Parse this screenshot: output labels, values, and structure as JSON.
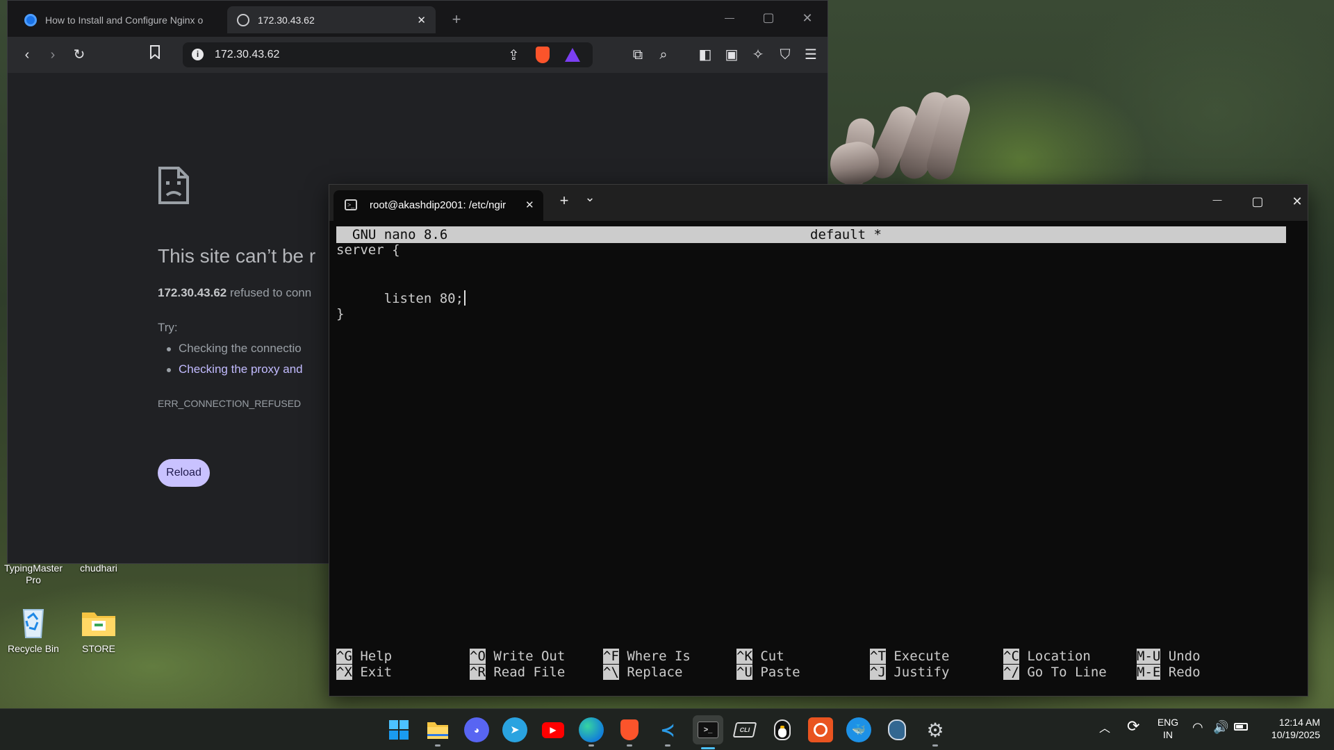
{
  "browser": {
    "tabs": [
      {
        "label": "How to Install and Configure Nginx o",
        "active": false
      },
      {
        "label": "172.30.43.62",
        "active": true
      }
    ],
    "new_tab": "+",
    "controls": {
      "minimize": "—",
      "maximize": "▢",
      "close": "✕"
    },
    "address": "172.30.43.62",
    "error": {
      "title": "This site can’t be r",
      "host": "172.30.43.62",
      "message": " refused to conn",
      "try_label": "Try:",
      "suggestions": [
        "Checking the connectio",
        "Checking the proxy and"
      ],
      "code": "ERR_CONNECTION_REFUSED",
      "reload_label": "Reload"
    }
  },
  "terminal": {
    "tab_title": "root@akashdip2001: /etc/ngir",
    "new_tab": "+",
    "dropdown": "⌄",
    "controls": {
      "minimize": "—",
      "maximize": "▢",
      "close": "✕"
    },
    "nano": {
      "version": "GNU nano 8.6",
      "filename": "default *",
      "lines": [
        "server {",
        "",
        "listen 80;",
        "",
        "}"
      ],
      "shortcuts": [
        {
          "key1": "^G",
          "label1": "Help",
          "key2": "^X",
          "label2": "Exit"
        },
        {
          "key1": "^O",
          "label1": "Write Out",
          "key2": "^R",
          "label2": "Read File"
        },
        {
          "key1": "^F",
          "label1": "Where Is",
          "key2": "^\\",
          "label2": "Replace"
        },
        {
          "key1": "^K",
          "label1": "Cut",
          "key2": "^U",
          "label2": "Paste"
        },
        {
          "key1": "^T",
          "label1": "Execute",
          "key2": "^J",
          "label2": "Justify"
        },
        {
          "key1": "^C",
          "label1": "Location",
          "key2": "^/",
          "label2": "Go To Line"
        },
        {
          "key1": "M-U",
          "label1": "Undo",
          "key2": "M-E",
          "label2": "Redo"
        }
      ]
    }
  },
  "desktop": {
    "icons": [
      {
        "label": "TypingMaster Pro"
      },
      {
        "label": "chudhari"
      },
      {
        "label": "Recycle Bin"
      },
      {
        "label": "STORE"
      }
    ]
  },
  "taskbar": {
    "apps": [
      "start",
      "file-explorer",
      "discord",
      "telegram",
      "youtube",
      "edge",
      "brave",
      "vscode",
      "terminal",
      "wsl-ubuntu-cli",
      "penguin",
      "ubuntu",
      "docker",
      "postgresql",
      "settings"
    ],
    "language": {
      "line1": "ENG",
      "line2": "IN"
    },
    "time": "12:14 AM",
    "date": "10/19/2025"
  },
  "colors": {
    "reload_button": "#c9c2ff",
    "nano_header": "#cccccc",
    "terminal_bg": "#0c0c0c",
    "taskbar_accent": "#4cc2ff"
  }
}
